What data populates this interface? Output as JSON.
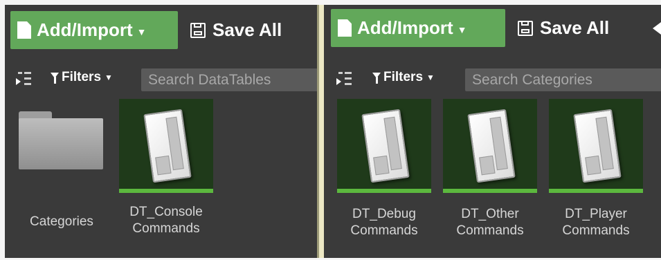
{
  "left_panel": {
    "add_import_label": "Add/Import",
    "save_all_label": "Save All",
    "filters_label": "Filters",
    "search_placeholder": "Search DataTables",
    "items": [
      {
        "type": "folder",
        "line1": "Categories",
        "line2": ""
      },
      {
        "type": "datatable",
        "line1": "DT_Console",
        "line2": "Commands"
      }
    ]
  },
  "right_panel": {
    "add_import_label": "Add/Import",
    "save_all_label": "Save All",
    "filters_label": "Filters",
    "search_placeholder": "Search Categories",
    "items": [
      {
        "type": "datatable",
        "line1": "DT_Debug",
        "line2": "Commands"
      },
      {
        "type": "datatable",
        "line1": "DT_Other",
        "line2": "Commands"
      },
      {
        "type": "datatable",
        "line1": "DT_Player",
        "line2": "Commands"
      }
    ]
  },
  "icons": {
    "add": "new-document-icon",
    "save": "floppy-disk-icon",
    "tree": "source-tree-toggle-icon",
    "filter": "funnel-icon",
    "back": "back-arrow-icon"
  },
  "colors": {
    "panel_bg": "#3a3a3a",
    "add_button": "#62a85a",
    "tile_bg": "#1f3a1a",
    "tile_bar": "#5cb83e"
  }
}
